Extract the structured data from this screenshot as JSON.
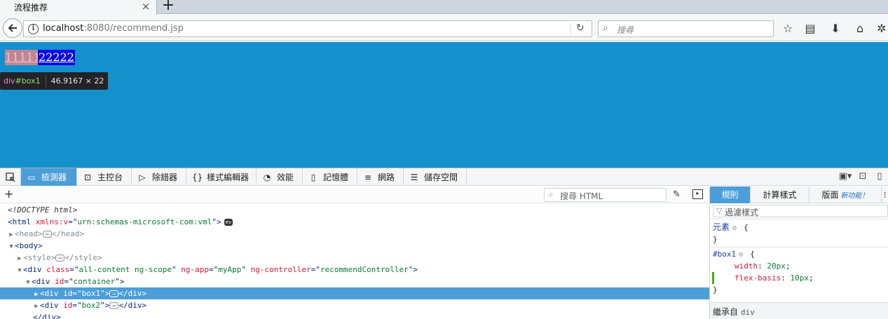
{
  "browser": {
    "tab_title": "流程推荐",
    "url_host": "localhost",
    "url_rest": ":8080/recommend.jsp",
    "search_placeholder": "搜尋"
  },
  "page": {
    "box1_text": "11111",
    "box2_text": "22222",
    "background_color": "#1490cd"
  },
  "highlighter": {
    "tag": "div",
    "id": "#box1",
    "dimensions": "46.9167 × 22"
  },
  "devtools": {
    "tabs": [
      {
        "label": "檢測器",
        "icon": "inspector-icon"
      },
      {
        "label": "主控台",
        "icon": "console-icon"
      },
      {
        "label": "除錯器",
        "icon": "debugger-icon"
      },
      {
        "label": "樣式編輯器",
        "icon": "style-editor-icon"
      },
      {
        "label": "效能",
        "icon": "performance-icon"
      },
      {
        "label": "記憶體",
        "icon": "memory-icon"
      },
      {
        "label": "網路",
        "icon": "network-icon"
      },
      {
        "label": "儲存空間",
        "icon": "storage-icon"
      }
    ],
    "html_search_placeholder": "搜尋 HTML",
    "markup": {
      "doctype": "<!DOCTYPE html>",
      "html_xmlns_attr": "xmlns:v",
      "html_xmlns_val": "urn:schemas-microsoft-com:vml",
      "ev_badge": "ev",
      "div_class_val": "all-content ng-scope",
      "div_ngapp_val": "myApp",
      "div_ngctrl_val": "recommendController",
      "container_id": "container",
      "box1_id": "box1",
      "box2_id": "box2"
    },
    "rules_tabs": {
      "rules": "規則",
      "computed": "計算樣式",
      "layout": "版面",
      "new_feature": "新功能！"
    },
    "filter_placeholder": "過濾樣式",
    "rules": {
      "element_selector": "元素",
      "box1_selector": "#box1",
      "decl1_prop": "width",
      "decl1_val": "20px",
      "decl2_prop": "flex-basis",
      "decl2_val": "10px",
      "inherited_label": "繼承自",
      "inherited_tag": "div"
    }
  }
}
